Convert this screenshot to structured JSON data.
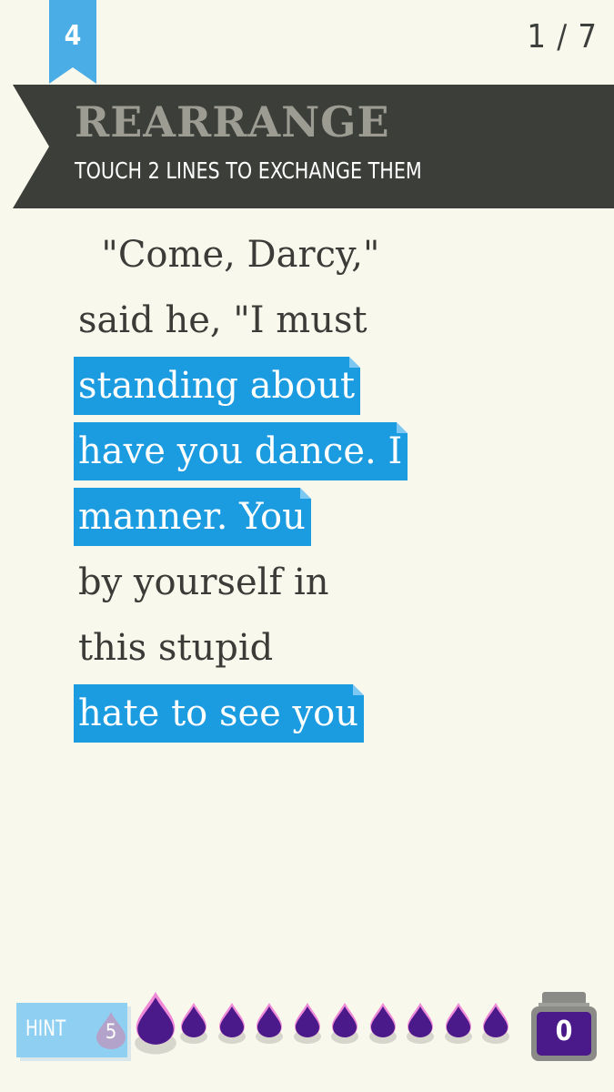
{
  "level": "4",
  "progress": "1 / 7",
  "banner": {
    "title": "REARRANGE",
    "subtitle": "TOUCH 2 LINES TO EXCHANGE THEM"
  },
  "poem_lines": [
    {
      "text": "  \"Come, Darcy,\"",
      "selected": false
    },
    {
      "text": "said he, \"I must",
      "selected": false
    },
    {
      "text": "standing about",
      "selected": true
    },
    {
      "text": "have you dance. I",
      "selected": true
    },
    {
      "text": "manner. You",
      "selected": true
    },
    {
      "text": "by yourself in",
      "selected": false
    },
    {
      "text": "this stupid",
      "selected": false
    },
    {
      "text": "hate to see you",
      "selected": true
    }
  ],
  "hint": {
    "label": "HINT",
    "count": "5"
  },
  "ink_drops": {
    "count": 10,
    "color": "#4a1a8a",
    "highlight_color": "#f08ad8"
  },
  "ink_jar": {
    "count": "0",
    "color": "#4a1a8a"
  },
  "colors": {
    "background": "#f9f8ec",
    "banner": "#3c3e3a",
    "accent_blue": "#1b9be0",
    "ribbon": "#4aade6"
  }
}
